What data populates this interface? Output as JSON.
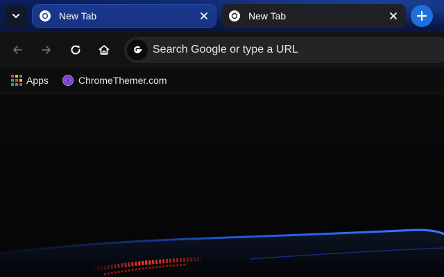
{
  "tab_strip": {
    "tab_search_label": "Search tabs",
    "tabs": [
      {
        "title": "New Tab",
        "active": true
      },
      {
        "title": "New Tab",
        "active": false
      }
    ],
    "new_tab_label": "New tab"
  },
  "toolbar": {
    "omnibox": {
      "placeholder": "Search Google or type a URL"
    }
  },
  "bookmarks_bar": {
    "items": [
      {
        "label": "Apps",
        "icon": "apps-grid-icon"
      },
      {
        "label": "ChromeThemer.com",
        "icon": "chromethemer-icon"
      }
    ]
  },
  "colors": {
    "tabstrip": "#0b1f5c",
    "active_tab": "#1a3a8c",
    "inactive_tab": "#1b1d22",
    "new_tab_button": "#1f6fdc",
    "toolbar": "#121314",
    "omnibox": "#232426",
    "content": "#050506"
  }
}
